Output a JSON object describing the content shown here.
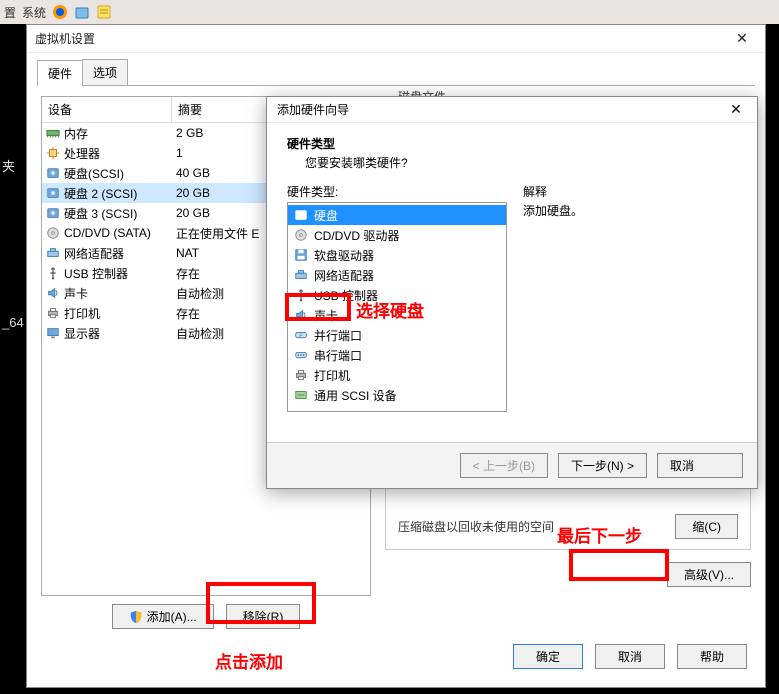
{
  "desktop_menu": {
    "item1": "置",
    "item2": "系统"
  },
  "side": {
    "label1": "夹",
    "label2": "_64"
  },
  "settings_window": {
    "title": "虚拟机设置",
    "tabs": {
      "hardware": "硬件",
      "options": "选项"
    },
    "columns": {
      "device": "设备",
      "summary": "摘要"
    },
    "rows": [
      {
        "icon": "memory",
        "name": "内存",
        "summary": "2 GB"
      },
      {
        "icon": "cpu",
        "name": "处理器",
        "summary": "1"
      },
      {
        "icon": "disk",
        "name": "硬盘(SCSI)",
        "summary": "40 GB"
      },
      {
        "icon": "disk",
        "name": "硬盘 2 (SCSI)",
        "summary": "20 GB",
        "selected": true
      },
      {
        "icon": "disk",
        "name": "硬盘 3 (SCSI)",
        "summary": "20 GB"
      },
      {
        "icon": "cd",
        "name": "CD/DVD (SATA)",
        "summary": "正在使用文件 E"
      },
      {
        "icon": "net",
        "name": "网络适配器",
        "summary": "NAT"
      },
      {
        "icon": "usb",
        "name": "USB 控制器",
        "summary": "存在"
      },
      {
        "icon": "sound",
        "name": "声卡",
        "summary": "自动检测"
      },
      {
        "icon": "printer",
        "name": "打印机",
        "summary": "存在"
      },
      {
        "icon": "display",
        "name": "显示器",
        "summary": "自动检测"
      }
    ],
    "add_btn": "添加(A)...",
    "remove_btn": "移除(R)",
    "right_group_title": "磁盘文件",
    "truncated_line": "压缩磁盘以回收未使用的空间",
    "truncated_btn": "缩(C)",
    "advanced_btn": "高级(V)...",
    "ok": "确定",
    "cancel": "取消",
    "help": "帮助"
  },
  "wizard": {
    "title": "添加硬件向导",
    "heading": "硬件类型",
    "subheading": "您要安装哪类硬件?",
    "left_label": "硬件类型:",
    "right_label": "解释",
    "right_text": "添加硬盘。",
    "items": [
      {
        "icon": "disk",
        "label": "硬盘",
        "selected": true
      },
      {
        "icon": "cd",
        "label": "CD/DVD 驱动器"
      },
      {
        "icon": "floppy",
        "label": "软盘驱动器"
      },
      {
        "icon": "net",
        "label": "网络适配器"
      },
      {
        "icon": "usb",
        "label": "USB 控制器"
      },
      {
        "icon": "sound",
        "label": "声卡"
      },
      {
        "icon": "parallel",
        "label": "并行端口"
      },
      {
        "icon": "serial",
        "label": "串行端口"
      },
      {
        "icon": "printer",
        "label": "打印机"
      },
      {
        "icon": "scsi",
        "label": "通用 SCSI 设备"
      }
    ],
    "back": "< 上一步(B)",
    "next": "下一步(N) >",
    "cancel": "取消"
  },
  "annotations": {
    "select_disk": "选择硬盘",
    "next_step": "最后下一步",
    "click_add": "点击添加"
  }
}
